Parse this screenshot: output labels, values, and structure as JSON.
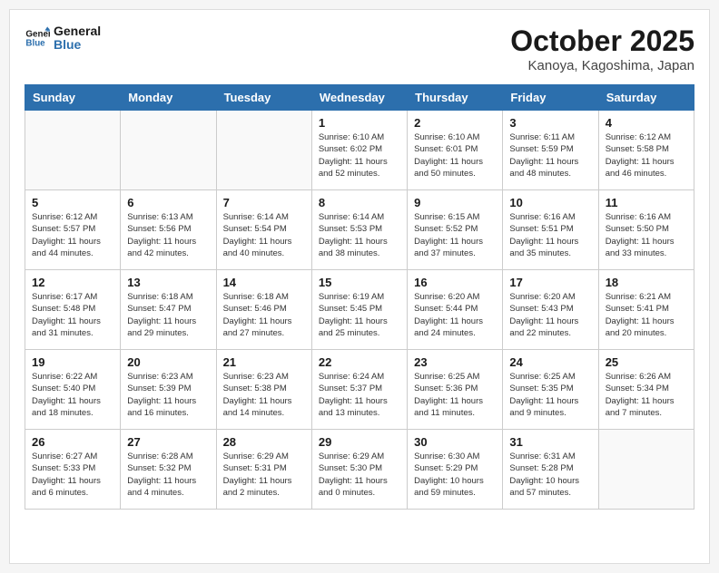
{
  "header": {
    "logo_line1": "General",
    "logo_line2": "Blue",
    "month": "October 2025",
    "location": "Kanoya, Kagoshima, Japan"
  },
  "weekdays": [
    "Sunday",
    "Monday",
    "Tuesday",
    "Wednesday",
    "Thursday",
    "Friday",
    "Saturday"
  ],
  "weeks": [
    [
      {
        "day": "",
        "info": ""
      },
      {
        "day": "",
        "info": ""
      },
      {
        "day": "",
        "info": ""
      },
      {
        "day": "1",
        "info": "Sunrise: 6:10 AM\nSunset: 6:02 PM\nDaylight: 11 hours\nand 52 minutes."
      },
      {
        "day": "2",
        "info": "Sunrise: 6:10 AM\nSunset: 6:01 PM\nDaylight: 11 hours\nand 50 minutes."
      },
      {
        "day": "3",
        "info": "Sunrise: 6:11 AM\nSunset: 5:59 PM\nDaylight: 11 hours\nand 48 minutes."
      },
      {
        "day": "4",
        "info": "Sunrise: 6:12 AM\nSunset: 5:58 PM\nDaylight: 11 hours\nand 46 minutes."
      }
    ],
    [
      {
        "day": "5",
        "info": "Sunrise: 6:12 AM\nSunset: 5:57 PM\nDaylight: 11 hours\nand 44 minutes."
      },
      {
        "day": "6",
        "info": "Sunrise: 6:13 AM\nSunset: 5:56 PM\nDaylight: 11 hours\nand 42 minutes."
      },
      {
        "day": "7",
        "info": "Sunrise: 6:14 AM\nSunset: 5:54 PM\nDaylight: 11 hours\nand 40 minutes."
      },
      {
        "day": "8",
        "info": "Sunrise: 6:14 AM\nSunset: 5:53 PM\nDaylight: 11 hours\nand 38 minutes."
      },
      {
        "day": "9",
        "info": "Sunrise: 6:15 AM\nSunset: 5:52 PM\nDaylight: 11 hours\nand 37 minutes."
      },
      {
        "day": "10",
        "info": "Sunrise: 6:16 AM\nSunset: 5:51 PM\nDaylight: 11 hours\nand 35 minutes."
      },
      {
        "day": "11",
        "info": "Sunrise: 6:16 AM\nSunset: 5:50 PM\nDaylight: 11 hours\nand 33 minutes."
      }
    ],
    [
      {
        "day": "12",
        "info": "Sunrise: 6:17 AM\nSunset: 5:48 PM\nDaylight: 11 hours\nand 31 minutes."
      },
      {
        "day": "13",
        "info": "Sunrise: 6:18 AM\nSunset: 5:47 PM\nDaylight: 11 hours\nand 29 minutes."
      },
      {
        "day": "14",
        "info": "Sunrise: 6:18 AM\nSunset: 5:46 PM\nDaylight: 11 hours\nand 27 minutes."
      },
      {
        "day": "15",
        "info": "Sunrise: 6:19 AM\nSunset: 5:45 PM\nDaylight: 11 hours\nand 25 minutes."
      },
      {
        "day": "16",
        "info": "Sunrise: 6:20 AM\nSunset: 5:44 PM\nDaylight: 11 hours\nand 24 minutes."
      },
      {
        "day": "17",
        "info": "Sunrise: 6:20 AM\nSunset: 5:43 PM\nDaylight: 11 hours\nand 22 minutes."
      },
      {
        "day": "18",
        "info": "Sunrise: 6:21 AM\nSunset: 5:41 PM\nDaylight: 11 hours\nand 20 minutes."
      }
    ],
    [
      {
        "day": "19",
        "info": "Sunrise: 6:22 AM\nSunset: 5:40 PM\nDaylight: 11 hours\nand 18 minutes."
      },
      {
        "day": "20",
        "info": "Sunrise: 6:23 AM\nSunset: 5:39 PM\nDaylight: 11 hours\nand 16 minutes."
      },
      {
        "day": "21",
        "info": "Sunrise: 6:23 AM\nSunset: 5:38 PM\nDaylight: 11 hours\nand 14 minutes."
      },
      {
        "day": "22",
        "info": "Sunrise: 6:24 AM\nSunset: 5:37 PM\nDaylight: 11 hours\nand 13 minutes."
      },
      {
        "day": "23",
        "info": "Sunrise: 6:25 AM\nSunset: 5:36 PM\nDaylight: 11 hours\nand 11 minutes."
      },
      {
        "day": "24",
        "info": "Sunrise: 6:25 AM\nSunset: 5:35 PM\nDaylight: 11 hours\nand 9 minutes."
      },
      {
        "day": "25",
        "info": "Sunrise: 6:26 AM\nSunset: 5:34 PM\nDaylight: 11 hours\nand 7 minutes."
      }
    ],
    [
      {
        "day": "26",
        "info": "Sunrise: 6:27 AM\nSunset: 5:33 PM\nDaylight: 11 hours\nand 6 minutes."
      },
      {
        "day": "27",
        "info": "Sunrise: 6:28 AM\nSunset: 5:32 PM\nDaylight: 11 hours\nand 4 minutes."
      },
      {
        "day": "28",
        "info": "Sunrise: 6:29 AM\nSunset: 5:31 PM\nDaylight: 11 hours\nand 2 minutes."
      },
      {
        "day": "29",
        "info": "Sunrise: 6:29 AM\nSunset: 5:30 PM\nDaylight: 11 hours\nand 0 minutes."
      },
      {
        "day": "30",
        "info": "Sunrise: 6:30 AM\nSunset: 5:29 PM\nDaylight: 10 hours\nand 59 minutes."
      },
      {
        "day": "31",
        "info": "Sunrise: 6:31 AM\nSunset: 5:28 PM\nDaylight: 10 hours\nand 57 minutes."
      },
      {
        "day": "",
        "info": ""
      }
    ]
  ]
}
